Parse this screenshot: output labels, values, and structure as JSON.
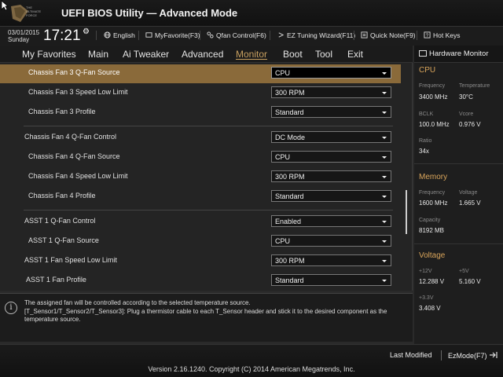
{
  "header": {
    "logo_line1": "THE",
    "logo_line2": "ULTIMATE",
    "logo_line3": "FORCE",
    "title": "UEFI BIOS Utility — Advanced Mode"
  },
  "infobar": {
    "date": "03/01/2015",
    "day": "Sunday",
    "time": "17:21",
    "language": "English",
    "myfavorite": "MyFavorite(F3)",
    "qfan": "Qfan Control(F6)",
    "ez_tuning": "EZ Tuning Wizard(F11)",
    "quick_note": "Quick Note(F9)",
    "hot_keys": "Hot Keys"
  },
  "tabs": [
    {
      "label": "My Favorites"
    },
    {
      "label": "Main"
    },
    {
      "label": "Ai Tweaker"
    },
    {
      "label": "Advanced"
    },
    {
      "label": "Monitor"
    },
    {
      "label": "Boot"
    },
    {
      "label": "Tool"
    },
    {
      "label": "Exit"
    }
  ],
  "active_tab": "Monitor",
  "settings": [
    {
      "label": "Chassis Fan 3 Q-Fan Source",
      "value": "CPU"
    },
    {
      "label": "Chassis Fan 3 Speed Low Limit",
      "value": "300 RPM"
    },
    {
      "label": "Chassis Fan 3 Profile",
      "value": "Standard"
    },
    {
      "label": "Chassis Fan 4 Q-Fan Control",
      "value": "DC Mode"
    },
    {
      "label": "Chassis Fan 4 Q-Fan Source",
      "value": "CPU"
    },
    {
      "label": "Chassis Fan 4 Speed Low Limit",
      "value": "300 RPM"
    },
    {
      "label": "Chassis Fan 4 Profile",
      "value": "Standard"
    },
    {
      "label": "ASST 1 Q-Fan Control",
      "value": "Enabled"
    },
    {
      "label": "ASST 1 Q-Fan Source",
      "value": "CPU"
    },
    {
      "label": "ASST 1 Fan Speed Low Limit",
      "value": "300 RPM"
    },
    {
      "label": "ASST 1 Fan Profile",
      "value": "Standard"
    }
  ],
  "help": {
    "line1": "The assigned fan will be controlled according to the selected temperature source.",
    "line2": "[T_Sensor1/T_Sensor2/T_Sensor3]: Plug a thermistor cable to each T_Sensor header and stick it to the desired component as the temperature source."
  },
  "hardware_monitor": {
    "title": "Hardware Monitor",
    "cpu": {
      "heading": "CPU",
      "frequency_label": "Frequency",
      "frequency": "3400 MHz",
      "temperature_label": "Temperature",
      "temperature": "30°C",
      "bclk_label": "BCLK",
      "bclk": "100.0 MHz",
      "vcore_label": "Vcore",
      "vcore": "0.976 V",
      "ratio_label": "Ratio",
      "ratio": "34x"
    },
    "memory": {
      "heading": "Memory",
      "frequency_label": "Frequency",
      "frequency": "1600 MHz",
      "voltage_label": "Voltage",
      "voltage": "1.665 V",
      "capacity_label": "Capacity",
      "capacity": "8192 MB"
    },
    "voltage": {
      "heading": "Voltage",
      "v12_label": "+12V",
      "v12": "12.288 V",
      "v5_label": "+5V",
      "v5": "5.160 V",
      "v33_label": "+3.3V",
      "v33": "3.408 V"
    }
  },
  "footer": {
    "last_modified": "Last Modified",
    "ezmode": "EzMode(F7)",
    "copyright": "Version 2.16.1240. Copyright (C) 2014 American Megatrends, Inc."
  },
  "colors": {
    "accent": "#d9a55b",
    "selected_row": "#8a6a3a"
  }
}
